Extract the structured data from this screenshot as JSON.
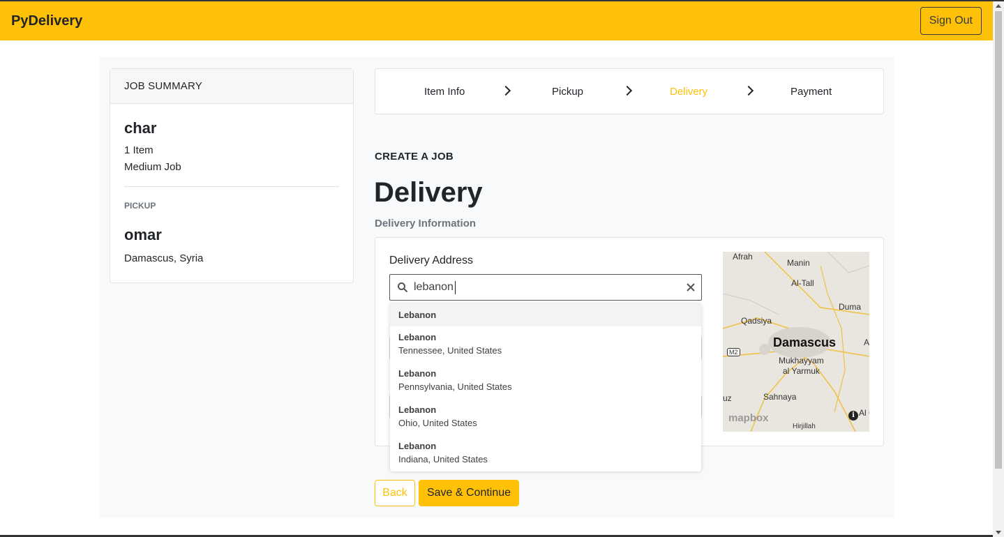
{
  "navbar": {
    "brand": "PyDelivery",
    "signout_label": "Sign Out"
  },
  "summary": {
    "header": "JOB SUMMARY",
    "job_name": "char",
    "item_count": "1 Item",
    "job_size": "Medium Job",
    "pickup_label": "PICKUP",
    "pickup_name": "omar",
    "pickup_address": "Damascus, Syria"
  },
  "steps": [
    {
      "label": "Item Info",
      "active": false
    },
    {
      "label": "Pickup",
      "active": false
    },
    {
      "label": "Delivery",
      "active": true
    },
    {
      "label": "Payment",
      "active": false
    }
  ],
  "main": {
    "create_label": "CREATE A JOB",
    "title": "Delivery",
    "subtitle": "Delivery Information"
  },
  "form": {
    "address_label": "Delivery Address",
    "search_value": "lebanon"
  },
  "suggestions": [
    {
      "title": "Lebanon",
      "sub": ""
    },
    {
      "title": "Lebanon",
      "sub": "Tennessee, United States"
    },
    {
      "title": "Lebanon",
      "sub": "Pennsylvania, United States"
    },
    {
      "title": "Lebanon",
      "sub": "Ohio, United States"
    },
    {
      "title": "Lebanon",
      "sub": "Indiana, United States"
    }
  ],
  "map": {
    "city": "Damascus",
    "labels": [
      "Afrah",
      "Manin",
      "Al-Tall",
      "Duma",
      "Qadsiya",
      "Mukhayyam",
      "al Yarmuk",
      "Sahnaya",
      "Hirjillah",
      "M2",
      "uz",
      "A",
      "Al Gh"
    ],
    "attribution": "mapbox"
  },
  "actions": {
    "back_label": "Back",
    "save_label": "Save & Continue"
  },
  "colors": {
    "accent": "#ffc107",
    "dark": "#212529",
    "muted": "#6c757d"
  }
}
